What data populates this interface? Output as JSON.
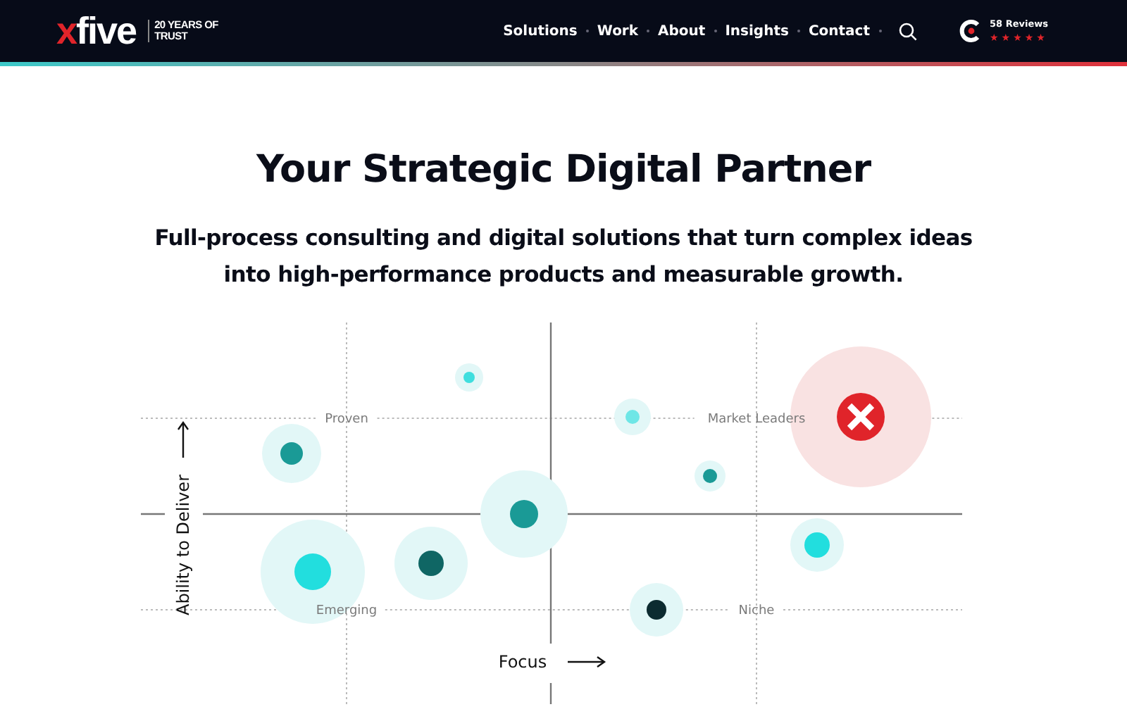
{
  "header": {
    "logo": {
      "accent": "x",
      "word": "five"
    },
    "tagline": [
      "20 YEARS OF",
      "TRUST"
    ],
    "nav": [
      {
        "label": "Solutions"
      },
      {
        "label": "Work"
      },
      {
        "label": "About"
      },
      {
        "label": "Insights"
      },
      {
        "label": "Contact"
      }
    ],
    "reviews": {
      "label": "58 Reviews",
      "stars": 5
    }
  },
  "hero": {
    "title": "Your Strategic Digital Partner",
    "subtitle": [
      "Full-process consulting and digital solutions that turn complex ideas",
      "into high-performance products and measurable growth."
    ]
  },
  "quadrant": {
    "y_axis": "Ability to Deliver",
    "x_axis": "Focus",
    "labels": [
      "Proven",
      "Market Leaders",
      "Emerging",
      "Niche"
    ]
  }
}
